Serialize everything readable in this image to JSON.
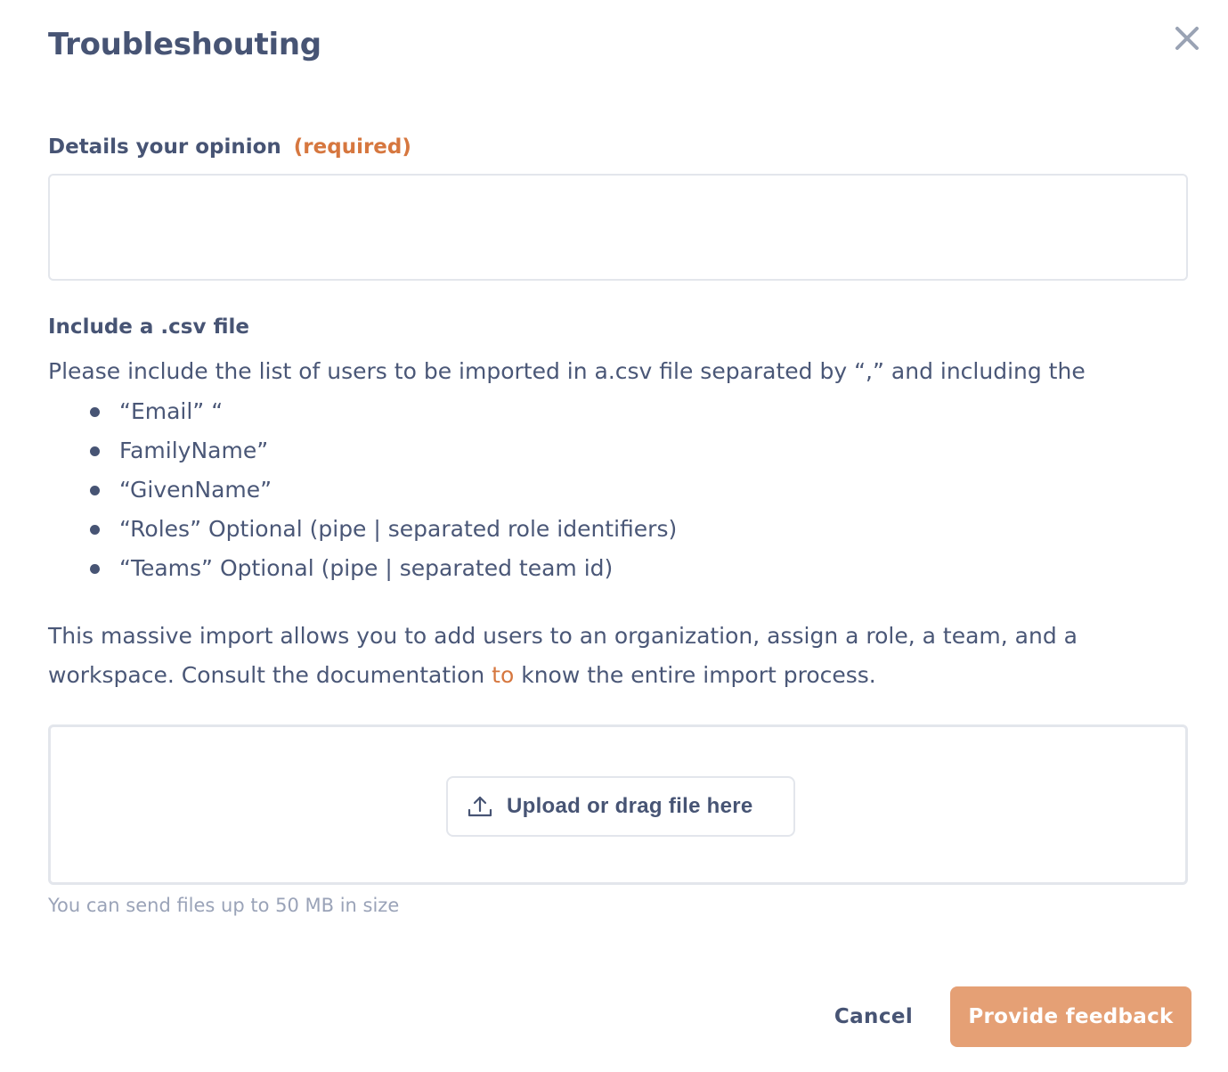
{
  "modal": {
    "title": "Troubleshouting",
    "close_icon": "close-icon"
  },
  "opinion": {
    "label": "Details your opinion",
    "required_tag": "(required)",
    "value": "",
    "placeholder": ""
  },
  "csv": {
    "title": "Include a .csv file",
    "intro": "Please include the list of users to be imported in a.csv file separated by “,” and including the",
    "columns": [
      "“Email” “",
      "FamilyName”",
      "“GivenName”",
      "“Roles” Optional (pipe | separated role identifiers)",
      "“Teams” Optional (pipe | separated team id)"
    ]
  },
  "description": {
    "before_link": "This massive import allows you to add users to an organization, assign a role, a team, and a workspace. Consult the documentation ",
    "link_text": "to",
    "after_link": " know the entire import process."
  },
  "upload": {
    "button_label": "Upload or drag file here",
    "icon": "upload-icon",
    "hint": "You can send files up to 50 MB in size"
  },
  "actions": {
    "cancel_label": "Cancel",
    "submit_label": "Provide feedback"
  },
  "colors": {
    "text": "#475474",
    "accent": "#d6773f",
    "submit_bg": "#e5a075",
    "border": "#e3e6ec",
    "hint": "#9aa3b8"
  }
}
